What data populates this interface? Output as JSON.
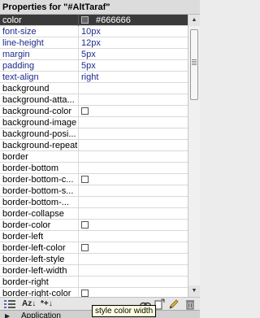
{
  "panel": {
    "title": "Properties for \"#AltTaraf\""
  },
  "properties": [
    {
      "name": "color",
      "value": "#666666",
      "swatch": true,
      "selected": true,
      "set": false
    },
    {
      "name": "font-size",
      "value": "10px",
      "swatch": false,
      "selected": false,
      "set": true
    },
    {
      "name": "line-height",
      "value": "12px",
      "swatch": false,
      "selected": false,
      "set": true
    },
    {
      "name": "margin",
      "value": "5px",
      "swatch": false,
      "selected": false,
      "set": true
    },
    {
      "name": "padding",
      "value": "5px",
      "swatch": false,
      "selected": false,
      "set": true
    },
    {
      "name": "text-align",
      "value": "right",
      "swatch": false,
      "selected": false,
      "set": true
    },
    {
      "name": "background",
      "value": "",
      "swatch": false,
      "selected": false,
      "set": false
    },
    {
      "name": "background-atta...",
      "value": "",
      "swatch": false,
      "selected": false,
      "set": false
    },
    {
      "name": "background-color",
      "value": "",
      "swatch": true,
      "selected": false,
      "set": false
    },
    {
      "name": "background-image",
      "value": "",
      "swatch": false,
      "selected": false,
      "set": false
    },
    {
      "name": "background-posi...",
      "value": "",
      "swatch": false,
      "selected": false,
      "set": false
    },
    {
      "name": "background-repeat",
      "value": "",
      "swatch": false,
      "selected": false,
      "set": false
    },
    {
      "name": "border",
      "value": "",
      "swatch": false,
      "selected": false,
      "set": false
    },
    {
      "name": "border-bottom",
      "value": "",
      "swatch": false,
      "selected": false,
      "set": false
    },
    {
      "name": "border-bottom-c...",
      "value": "",
      "swatch": true,
      "selected": false,
      "set": false
    },
    {
      "name": "border-bottom-s...",
      "value": "",
      "swatch": false,
      "selected": false,
      "set": false
    },
    {
      "name": "border-bottom-...",
      "value": "",
      "swatch": false,
      "selected": false,
      "set": false
    },
    {
      "name": "border-collapse",
      "value": "",
      "swatch": false,
      "selected": false,
      "set": false
    },
    {
      "name": "border-color",
      "value": "",
      "swatch": true,
      "selected": false,
      "set": false
    },
    {
      "name": "border-left",
      "value": "",
      "swatch": false,
      "selected": false,
      "set": false
    },
    {
      "name": "border-left-color",
      "value": "",
      "swatch": true,
      "selected": false,
      "set": false
    },
    {
      "name": "border-left-style",
      "value": "",
      "swatch": false,
      "selected": false,
      "set": false
    },
    {
      "name": "border-left-width",
      "value": "",
      "swatch": false,
      "selected": false,
      "set": false
    },
    {
      "name": "border-right",
      "value": "",
      "swatch": false,
      "selected": false,
      "set": false
    },
    {
      "name": "border-right-color",
      "value": "",
      "swatch": true,
      "selected": false,
      "set": false
    }
  ],
  "toolbar": {
    "category_icon": "category-view-icon",
    "sort_label": "Az↓",
    "set_only_label": "*+↓",
    "link_icon": "attach-stylesheet-icon",
    "new_rule_icon": "new-rule-icon",
    "edit_icon": "edit-rule-icon",
    "delete_icon": "delete-rule-icon"
  },
  "tooltip": {
    "text": "style color width"
  },
  "bottom_panel": {
    "label": "Application"
  }
}
